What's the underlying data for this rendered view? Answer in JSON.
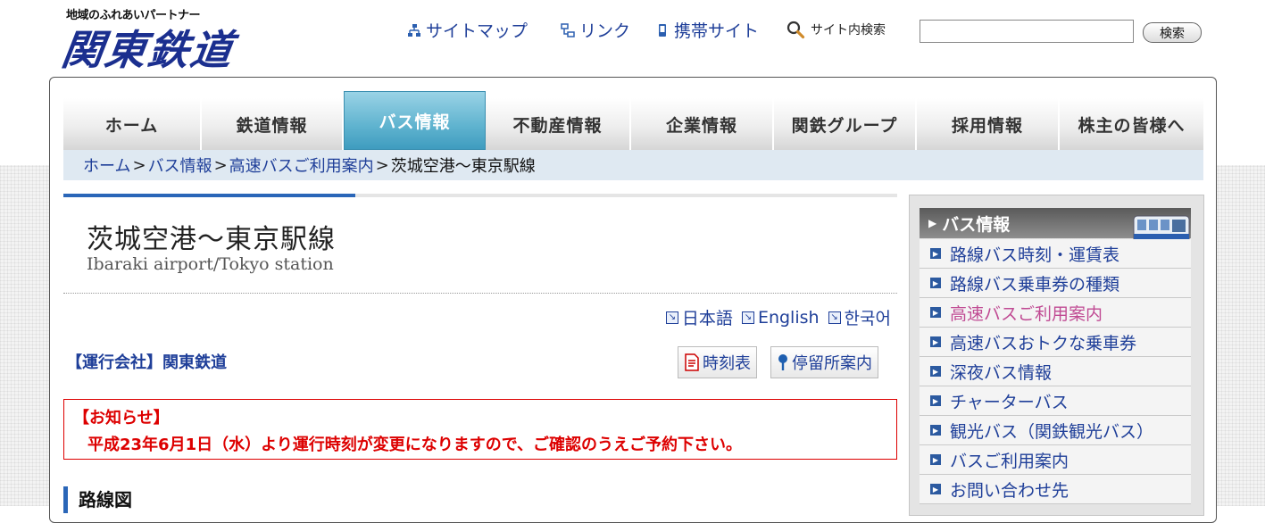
{
  "header": {
    "tagline": "地域のふれあいパートナー",
    "logo": "関東鉄道",
    "links": [
      {
        "label": "サイトマップ",
        "icon": "sitemap-icon"
      },
      {
        "label": "リンク",
        "icon": "link-icon"
      },
      {
        "label": "携帯サイト",
        "icon": "mobile-icon"
      }
    ],
    "search": {
      "label": "サイト内検索",
      "value": "",
      "button": "検索"
    }
  },
  "tabs": [
    {
      "label": "ホーム",
      "active": false
    },
    {
      "label": "鉄道情報",
      "active": false
    },
    {
      "label": "バス情報",
      "active": true
    },
    {
      "label": "不動産情報",
      "active": false
    },
    {
      "label": "企業情報",
      "active": false
    },
    {
      "label": "関鉄グループ",
      "active": false
    },
    {
      "label": "採用情報",
      "active": false
    },
    {
      "label": "株主の皆様へ",
      "active": false
    }
  ],
  "breadcrumb": {
    "items": [
      "ホーム",
      "バス情報",
      "高速バスご利用案内"
    ],
    "separator": ">",
    "current": "茨城空港〜東京駅線"
  },
  "main": {
    "title": "茨城空港〜東京駅線",
    "subtitle": "Ibaraki airport/Tokyo station",
    "languages": [
      "日本語",
      "English",
      "한국어"
    ],
    "operator": "【運行会社】関東鉄道",
    "timetable_button": "時刻表",
    "stops_button": "停留所案内",
    "notice_heading": "【お知らせ】",
    "notice_body": "平成23年6月1日（水）より運行時刻が変更になりますので、ご確認のうえご予約下さい。",
    "section_heading": "路線図"
  },
  "sidebar": {
    "heading": "バス情報",
    "items": [
      {
        "label": "路線バス時刻・運賃表",
        "active": false
      },
      {
        "label": "路線バス乗車券の種類",
        "active": false
      },
      {
        "label": "高速バスご利用案内",
        "active": true
      },
      {
        "label": "高速バスおトクな乗車券",
        "active": false
      },
      {
        "label": "深夜バス情報",
        "active": false
      },
      {
        "label": "チャーターバス",
        "active": false
      },
      {
        "label": "観光バス（関鉄観光バス）",
        "active": false
      },
      {
        "label": "バスご利用案内",
        "active": false
      },
      {
        "label": "お問い合わせ先",
        "active": false
      }
    ]
  },
  "colors": {
    "brand": "#1b2f8f",
    "link": "#1f3f99",
    "active_tab": "#5fb3cf",
    "notice": "#dd0000",
    "active_side": "#c04a93"
  }
}
